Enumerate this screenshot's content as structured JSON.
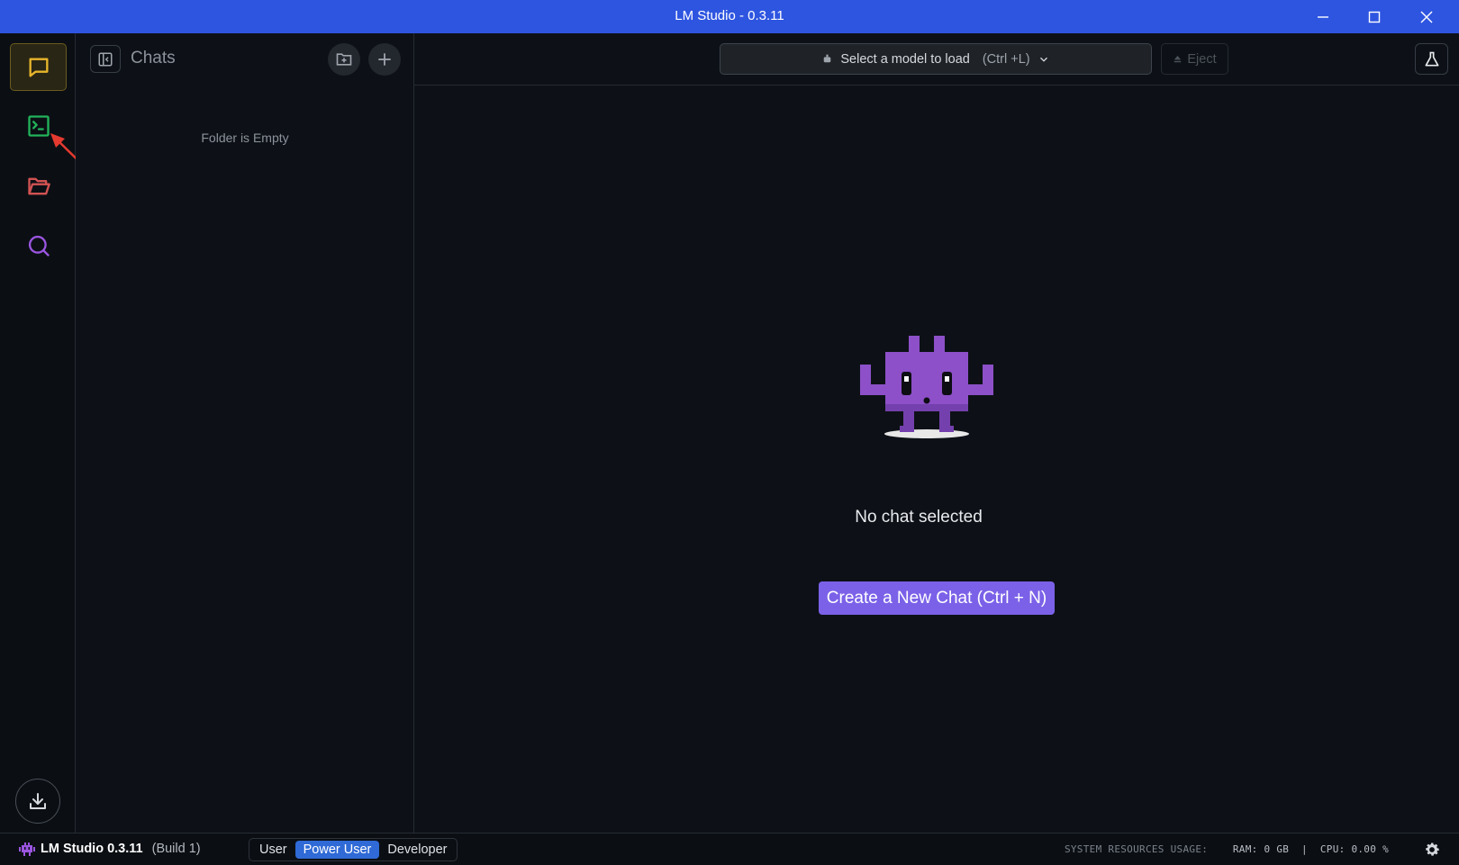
{
  "window": {
    "title": "LM Studio - 0.3.11",
    "controls": [
      "minimize-icon",
      "maximize-icon",
      "close-icon"
    ]
  },
  "rail": {
    "items": [
      {
        "name": "chat",
        "icon": "chat-bubble-icon",
        "color": "#e8b62c",
        "active": true
      },
      {
        "name": "developer",
        "icon": "terminal-icon",
        "color": "#22b35a",
        "active": false
      },
      {
        "name": "my-models",
        "icon": "folder-open-icon",
        "color": "#d25353",
        "active": false
      },
      {
        "name": "discover",
        "icon": "search-icon",
        "color": "#9b55e0",
        "active": false
      }
    ],
    "download_icon": "download-icon"
  },
  "chats_panel": {
    "title": "Chats",
    "empty_text": "Folder is Empty"
  },
  "topbar": {
    "model_select_label": "Select a model to load",
    "model_select_shortcut": "(Ctrl +L)",
    "eject_label": "Eject"
  },
  "main": {
    "empty_message": "No chat selected",
    "new_chat_button": "Create a New Chat (Ctrl + N)"
  },
  "statusbar": {
    "app_name": "LM Studio 0.3.11",
    "build": "(Build 1)",
    "modes": [
      "User",
      "Power User",
      "Developer"
    ],
    "active_mode": "Power User",
    "resources_label": "SYSTEM RESOURCES USAGE:",
    "ram": "RAM: 0 GB",
    "separator": "|",
    "cpu": "CPU: 0.00 %"
  },
  "colors": {
    "titlebar": "#2e55e0",
    "accent_purple": "#7b61e8",
    "mode_active": "#2f6ad6"
  }
}
